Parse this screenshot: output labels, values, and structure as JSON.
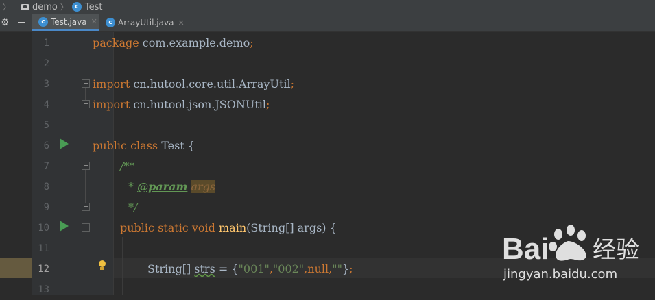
{
  "breadcrumb": {
    "items": [
      {
        "label": "demo",
        "icon": "folder-icon"
      },
      {
        "label": "Test",
        "icon": "class-icon"
      }
    ]
  },
  "toolbar": {
    "gear_icon": "gear-icon",
    "hide_icon": "minimize-icon"
  },
  "tabs": [
    {
      "label": "Test.java",
      "active": true,
      "icon_letter": "c"
    },
    {
      "label": "ArrayUtil.java",
      "active": false,
      "icon_letter": "c"
    }
  ],
  "line_numbers": [
    "1",
    "2",
    "3",
    "4",
    "5",
    "6",
    "7",
    "8",
    "9",
    "10",
    "11",
    "12",
    "13"
  ],
  "current_line": "12",
  "code": {
    "l1": {
      "kw": "package",
      "rest": " com.example.demo",
      "semi": ";"
    },
    "l3": {
      "kw": "import",
      "rest": " cn.hutool.core.util.ArrayUtil",
      "semi": ";"
    },
    "l4": {
      "kw": "import",
      "rest": " cn.hutool.json.JSONUtil",
      "semi": ";"
    },
    "l6": {
      "kw1": "public",
      "kw2": "class",
      "name": "Test",
      "brace": "{"
    },
    "l7": {
      "doc": "/**"
    },
    "l8": {
      "star": "* ",
      "tag": "@param",
      "param": "args"
    },
    "l9": {
      "doc": "*/"
    },
    "l10": {
      "kw1": "public",
      "kw2": "static",
      "kw3": "void",
      "fn": "main",
      "args": "(String[] args) {"
    },
    "l12": {
      "type": "String[] ",
      "var": "strs",
      "eq": " = {",
      "s1": "\"001\"",
      "c1": ",",
      "s2": "\"002\"",
      "c2": ",",
      "nul": "null",
      "c3": ",",
      "s3": "\"\"",
      "end": "}",
      "semi": ";"
    }
  },
  "colors": {
    "keyword": "#cc7832",
    "string": "#6a8759",
    "doc": "#629755",
    "function": "#ffc66d",
    "text": "#a9b7c6",
    "run": "#499c54"
  },
  "watermark": {
    "logo": "Bai百度经验",
    "url": "jingyan.baidu.com"
  }
}
